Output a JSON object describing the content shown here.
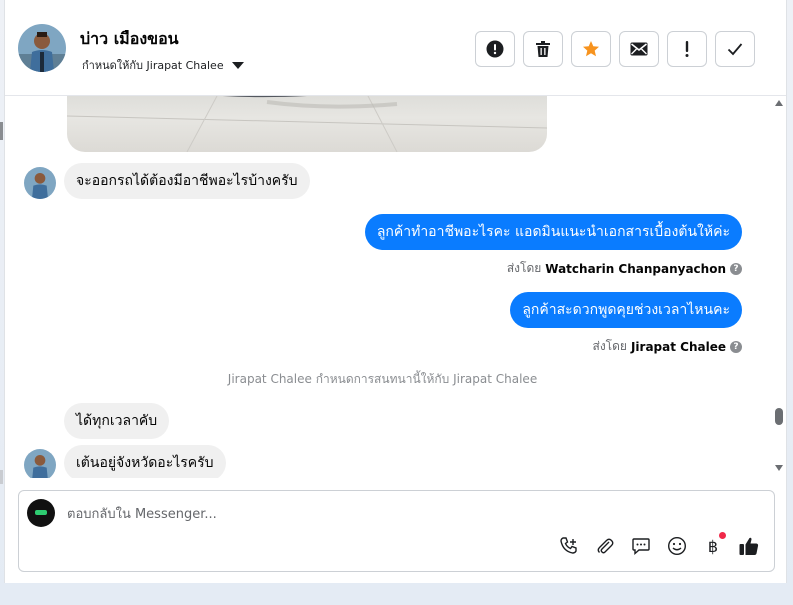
{
  "header": {
    "name": "บ่าว เมืองขอน",
    "assigned_to": "กำหนดให้กับ Jirapat Chalee",
    "actions": [
      {
        "icon": "alert-circle-icon",
        "label": "spam"
      },
      {
        "icon": "trash-icon",
        "label": "delete"
      },
      {
        "icon": "star-icon",
        "label": "star"
      },
      {
        "icon": "mail-icon",
        "label": "mark unread"
      },
      {
        "icon": "exclamation-icon",
        "label": "follow up"
      },
      {
        "icon": "check-icon",
        "label": "done"
      }
    ]
  },
  "messages": [
    {
      "direction": "in",
      "text": "จะออกรถได้ต้องมีอาชีพอะไรบ้างครับ"
    },
    {
      "direction": "out",
      "text": "ลูกค้าทำอาชีพอะไรคะ แอดมินแนะนำเอกสารเบื้องต้นให้ค่ะ",
      "sent_by_prefix": "ส่งโดย",
      "sent_by": "Watcharin Chanpanyachon"
    },
    {
      "direction": "out",
      "text": "ลูกค้าสะดวกพูดคุยช่วงเวลาไหนคะ",
      "sent_by_prefix": "ส่งโดย",
      "sent_by": "Jirapat Chalee"
    },
    {
      "direction": "in",
      "text": "ได้ทุกเวลาคับ"
    },
    {
      "direction": "in",
      "text": "เต้นอยู่จังหวัดอะไรครับ"
    }
  ],
  "system_note": "Jirapat Chalee กำหนดการสนทนานี้ให้กับ Jirapat Chalee",
  "composer": {
    "placeholder": "ตอบกลับใน Messenger...",
    "value": "",
    "tools": [
      "phone-plus-icon",
      "paperclip-icon",
      "saved-reply-icon",
      "emoji-icon",
      "baht-icon",
      "thumbs-up-icon"
    ]
  },
  "colors": {
    "outgoing_bubble": "#0a7cff",
    "incoming_bubble": "#f0f0f0",
    "star": "#f7931e"
  }
}
